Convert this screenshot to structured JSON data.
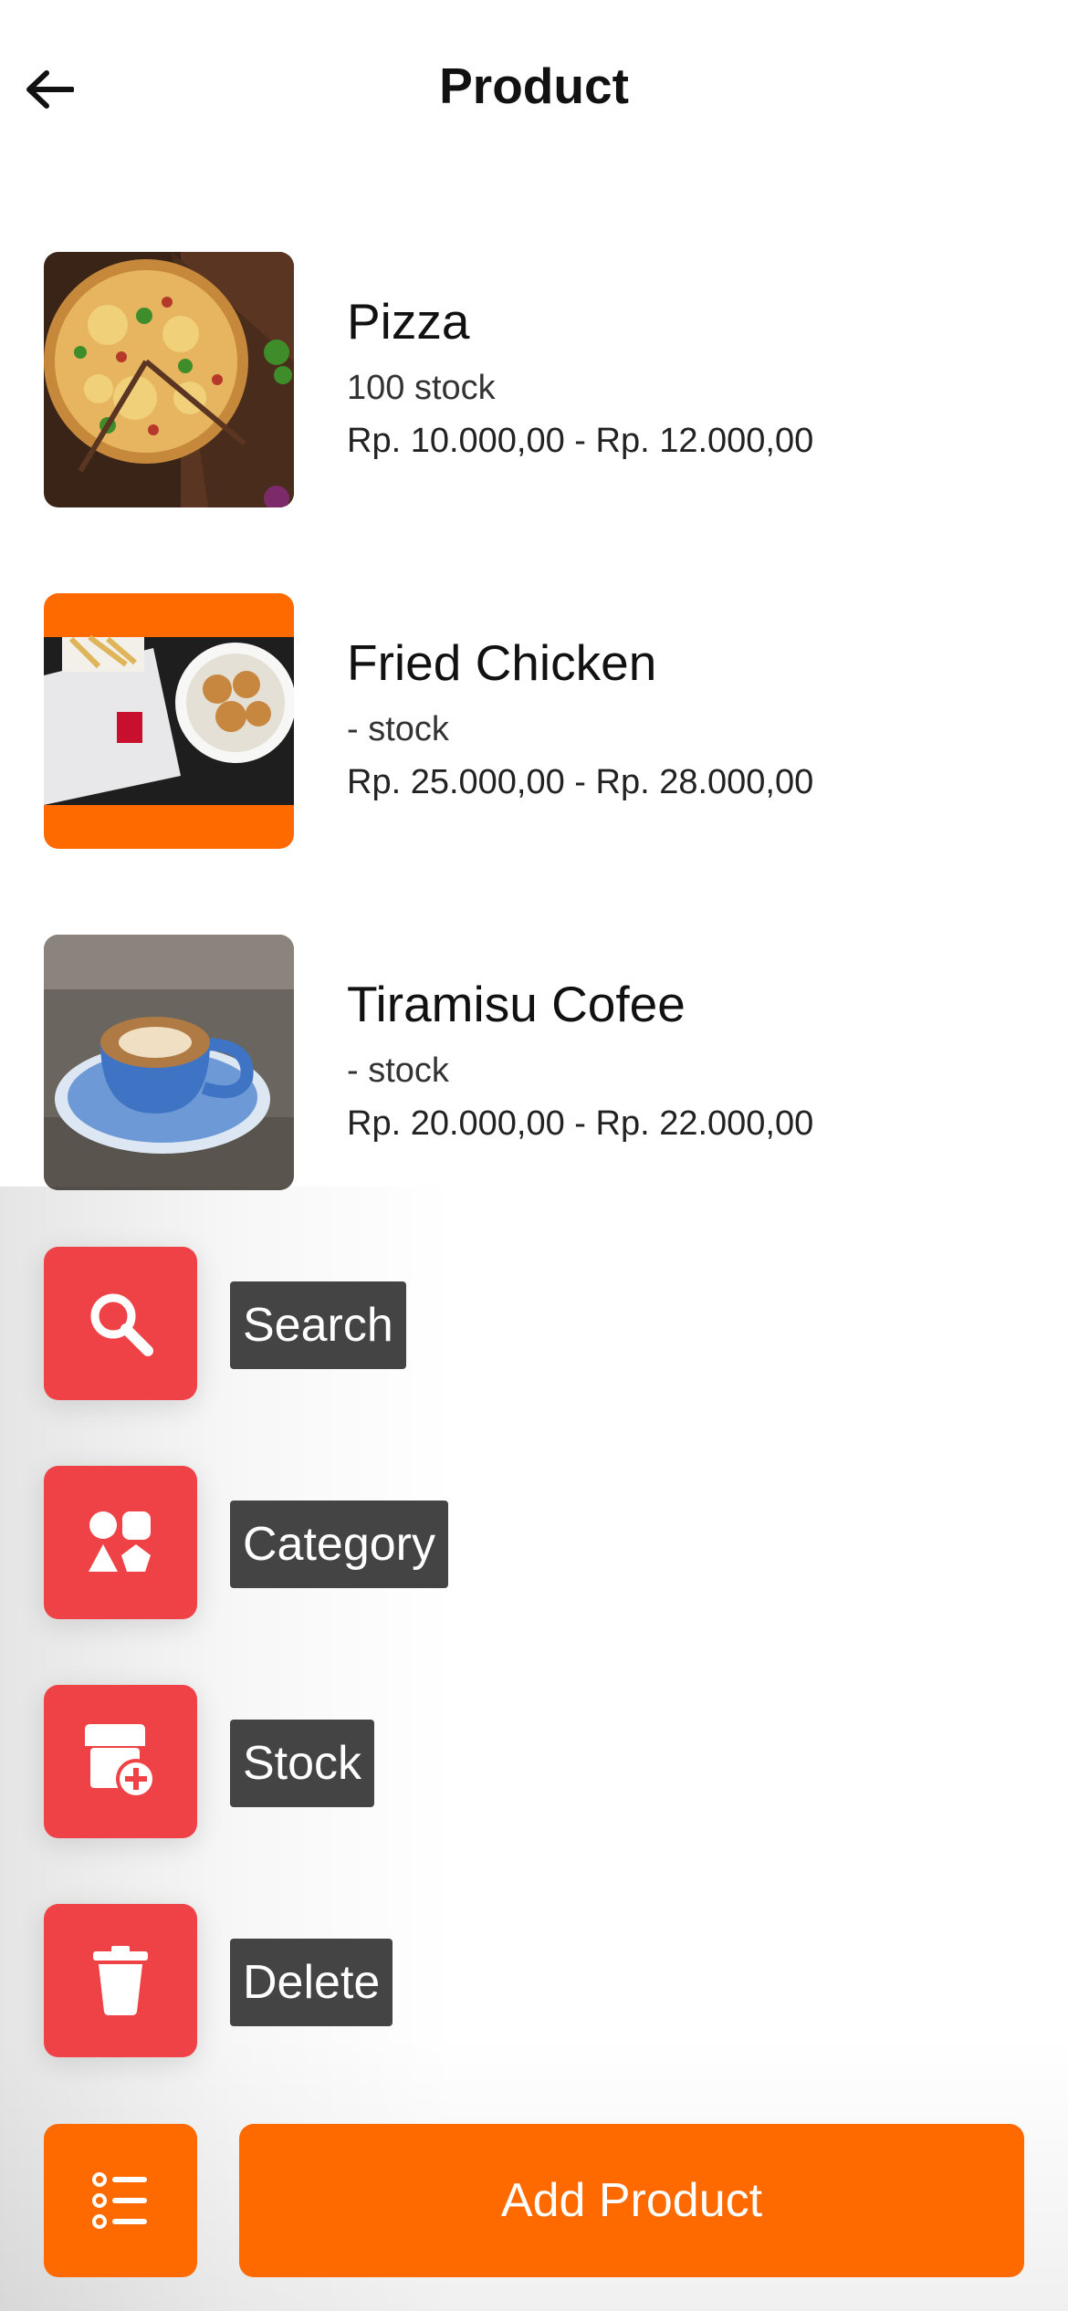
{
  "header": {
    "title": "Product",
    "back_icon": "arrow-left-icon"
  },
  "products": [
    {
      "name": "Pizza",
      "stock": "100 stock",
      "price": "Rp. 10.000,00 - Rp. 12.000,00",
      "image": "pizza-photo"
    },
    {
      "name": "Fried Chicken",
      "stock": "- stock",
      "price": "Rp. 25.000,00 - Rp. 28.000,00",
      "image": "fried-chicken-photo"
    },
    {
      "name": "Tiramisu Cofee",
      "stock": "- stock",
      "price": "Rp. 20.000,00 - Rp. 22.000,00",
      "image": "coffee-photo"
    }
  ],
  "speed_dial": [
    {
      "label": "Search",
      "icon": "search-icon"
    },
    {
      "label": "Category",
      "icon": "category-icon"
    },
    {
      "label": "Stock",
      "icon": "stock-add-icon"
    },
    {
      "label": "Delete",
      "icon": "trash-icon"
    }
  ],
  "bottom_bar": {
    "menu_icon": "list-icon",
    "add_label": "Add Product"
  },
  "colors": {
    "accent": "#ff6a00",
    "fab": "#ef4247",
    "label_bg": "#444444"
  }
}
